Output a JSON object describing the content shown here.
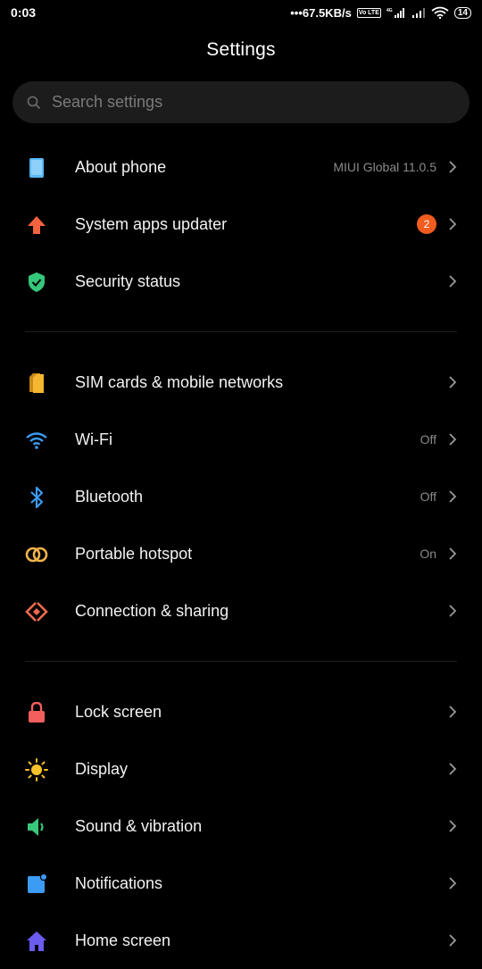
{
  "status_bar": {
    "time": "0:03",
    "speed": "67.5KB/s",
    "volte": "Vo LTE",
    "network_label": "4G",
    "battery": "14"
  },
  "header": {
    "title": "Settings"
  },
  "search": {
    "placeholder": "Search settings"
  },
  "groups": [
    [
      {
        "label": "About phone",
        "value": "MIUI Global 11.0.5",
        "icon": "phone-info-icon",
        "color": "#59b7f5"
      },
      {
        "label": "System apps updater",
        "badge": "2",
        "icon": "arrow-up-icon",
        "color": "#f4623f"
      },
      {
        "label": "Security status",
        "icon": "shield-check-icon",
        "color": "#34c77b"
      }
    ],
    [
      {
        "label": "SIM cards & mobile networks",
        "icon": "sim-card-icon",
        "color": "#f5b731"
      },
      {
        "label": "Wi-Fi",
        "value": "Off",
        "icon": "wifi-icon",
        "color": "#3c9bf3"
      },
      {
        "label": "Bluetooth",
        "value": "Off",
        "icon": "bluetooth-icon",
        "color": "#3c9bf3"
      },
      {
        "label": "Portable hotspot",
        "value": "On",
        "icon": "hotspot-icon",
        "color": "#f0b34a"
      },
      {
        "label": "Connection & sharing",
        "icon": "share-connection-icon",
        "color": "#f06a4e"
      }
    ],
    [
      {
        "label": "Lock screen",
        "icon": "lock-icon",
        "color": "#f25f5c"
      },
      {
        "label": "Display",
        "icon": "sun-icon",
        "color": "#f5c22b"
      },
      {
        "label": "Sound & vibration",
        "icon": "speaker-icon",
        "color": "#38c77b"
      },
      {
        "label": "Notifications",
        "icon": "notification-icon",
        "color": "#3c9bf3"
      },
      {
        "label": "Home screen",
        "icon": "home-icon",
        "color": "#6b5cf0"
      }
    ]
  ]
}
